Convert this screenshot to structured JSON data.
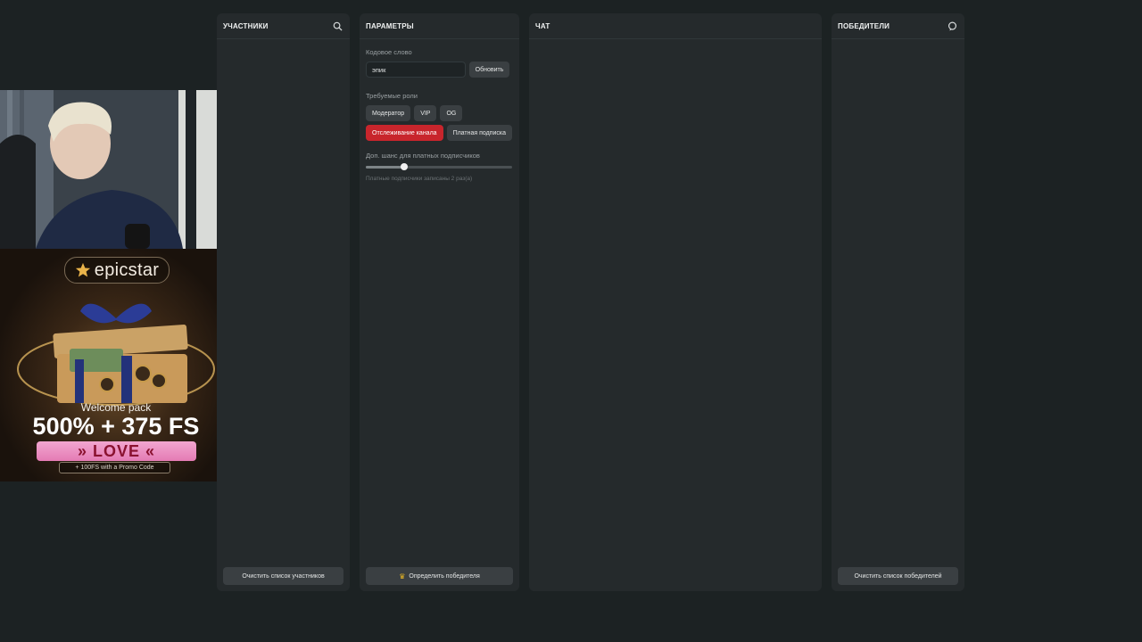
{
  "participants": {
    "title": "УЧАСТНИКИ",
    "search_icon": "search-icon",
    "clear_button": "Очистить список участников"
  },
  "params": {
    "title": "ПАРАМЕТРЫ",
    "codeword_label": "Кодовое слово",
    "codeword_value": "эпик",
    "update_button": "Обновить",
    "roles_label": "Требуемые роли",
    "roles": [
      {
        "label": "Модератор",
        "active": false
      },
      {
        "label": "VIP",
        "active": false
      },
      {
        "label": "OG",
        "active": false
      },
      {
        "label": "Отслеживание канала",
        "active": true
      },
      {
        "label": "Платная подписка",
        "active": false
      }
    ],
    "chance_label": "Доп. шанс для платных подписчиков",
    "chance_slider_fraction": 0.26,
    "chance_hint": "Платные подписчики записаны 2 раз(а)",
    "pick_winner_button": "Определить победителя",
    "accent_color": "#c8252c"
  },
  "chat": {
    "title": "ЧАТ"
  },
  "winners": {
    "title": "ПОБЕДИТЕЛИ",
    "icon": "chat-bubble-icon",
    "clear_button": "Очистить список победителей"
  },
  "ad": {
    "brand": "epicstar",
    "subtitle": "Welcome pack",
    "headline": "500% + 375 FS",
    "promo": "» LOVE «",
    "note": "+ 100FS with a Promo Code"
  }
}
